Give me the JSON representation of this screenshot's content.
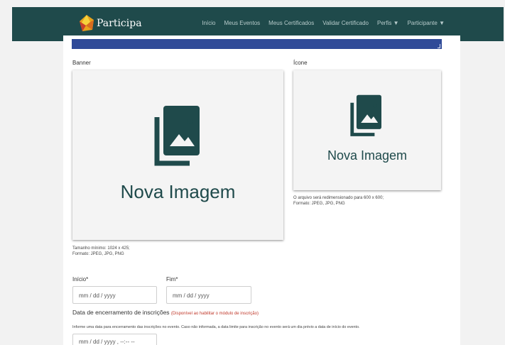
{
  "app": {
    "name": "Participa"
  },
  "nav": {
    "items": [
      "Início",
      "Meus Eventos",
      "Meus Certificados",
      "Validar Certificado",
      "Perfis",
      "Participante"
    ]
  },
  "banner": {
    "label": "Banner",
    "placeholder_text": "Nova Imagem",
    "min_size": "Tamanho mínimo: 1024 x 425;",
    "format": "Formato: JPEG, JPG, PNG"
  },
  "icon": {
    "label": "Ícone",
    "placeholder_text": "Nova Imagem",
    "resize_note": "O arquivo será redimensionado para 600 x 600;",
    "format": "Formato: JPEG, JPG, PNG"
  },
  "dates": {
    "start_label": "Início*",
    "start_placeholder": "mm / dd / yyyy",
    "end_label": "Fim*",
    "end_placeholder": "mm / dd / yyyy"
  },
  "registration": {
    "title": "Data de encerramento de inscrições",
    "warning": "(Disponível ao habilitar o módulo de inscrição)",
    "help": "Informe uma data para encerramento das inscrições no evento. Caso não informada, a data limite para inscrição no evento será um dia prévio a data de início do evento.",
    "placeholder": "mm / dd / yyyy , --:-- --"
  },
  "colors": {
    "navbar": "#1f4a4b",
    "accent_bar": "#2f4a98",
    "placeholder_icon": "#1f4a4b",
    "warning": "#c0392b"
  },
  "icons": {
    "brand": "participa-logo-icon",
    "image_placeholder": "image-gallery-icon"
  }
}
